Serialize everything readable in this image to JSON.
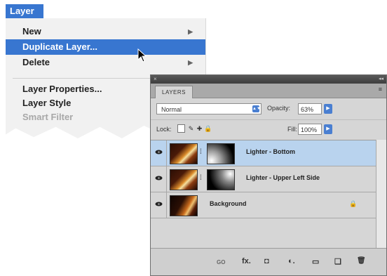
{
  "menu": {
    "title": "Layer",
    "items": [
      {
        "label": "New",
        "submenu": true
      },
      {
        "label": "Duplicate Layer...",
        "highlighted": true
      },
      {
        "label": "Delete",
        "submenu": true
      },
      {
        "label": "Layer Properties..."
      },
      {
        "label": "Layer Style"
      },
      {
        "label": "Smart Filter",
        "disabled": true
      }
    ],
    "submenu_arrow": "▶"
  },
  "panel": {
    "tab": "LAYERS",
    "close_icon": "×",
    "collapse_icon": "◂◂",
    "menu_icon": "≡",
    "blend_mode": "Normal",
    "opacity_label": "Opacity:",
    "opacity_value": "63%",
    "lock_label": "Lock:",
    "fill_label": "Fill:",
    "fill_value": "100%",
    "layers": [
      {
        "name": "Lighter - Bottom",
        "selected": true,
        "has_mask": true
      },
      {
        "name": "Lighter - Upper Left Side",
        "selected": false,
        "has_mask": true
      },
      {
        "name": "Background",
        "selected": false,
        "has_mask": false,
        "locked": true
      }
    ],
    "bottom_buttons": [
      "GO",
      "fx.",
      "◘",
      "◐.",
      "▭",
      "❏",
      "🗑"
    ]
  },
  "colors": {
    "highlight": "#3876d0",
    "selected_row": "#b9d3ee"
  }
}
